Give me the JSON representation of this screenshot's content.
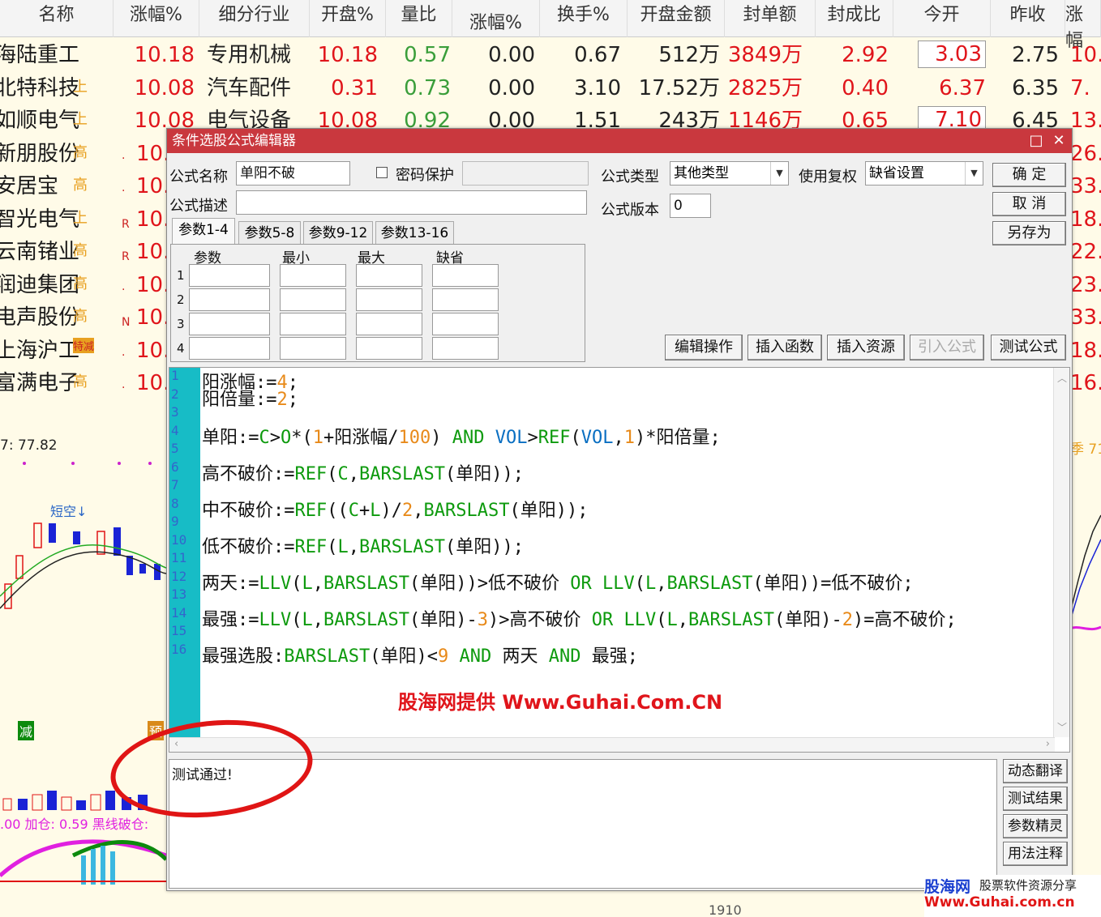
{
  "table": {
    "headers": [
      "名称",
      "涨幅%",
      "细分行业",
      "开盘%",
      "量比",
      "涨幅%",
      "换手%",
      "开盘金额",
      "封单额",
      "封成比",
      "今开",
      "昨收",
      "涨幅"
    ],
    "rows": [
      {
        "name": "海陆重工",
        "tag": "",
        "flag": "",
        "pct": "10.18",
        "industry": "专用机械",
        "open_pct": "10.18",
        "vol_ratio": "0.57",
        "sub_pct": "0.00",
        "turnover": "0.67",
        "open_amt": "512万",
        "seal_amt": "3849万",
        "seal_ratio": "2.92",
        "today_open": "3.03",
        "prev_close": "2.75",
        "last": "10."
      },
      {
        "name": "北特科技",
        "tag": "上",
        "flag": "",
        "pct": "10.08",
        "industry": "汽车配件",
        "open_pct": "0.31",
        "vol_ratio": "0.73",
        "sub_pct": "0.00",
        "turnover": "3.10",
        "open_amt": "17.52万",
        "seal_amt": "2825万",
        "seal_ratio": "0.40",
        "today_open": "6.37",
        "prev_close": "6.35",
        "last": "7."
      },
      {
        "name": "如顺电气",
        "tag": "上",
        "flag": "",
        "pct": "10.08",
        "industry": "电气设备",
        "open_pct": "10.08",
        "vol_ratio": "0.92",
        "sub_pct": "0.00",
        "turnover": "1.51",
        "open_amt": "243万",
        "seal_amt": "1146万",
        "seal_ratio": "0.65",
        "today_open": "7.10",
        "prev_close": "6.45",
        "last": "13."
      },
      {
        "name": "新朋股份",
        "tag": "高",
        "flag": "·",
        "pct": "10.",
        "last": "26."
      },
      {
        "name": "安居宝",
        "tag": "高",
        "flag": "·",
        "pct": "10.",
        "last": "33."
      },
      {
        "name": "智光电气",
        "tag": "上",
        "flag": "R",
        "pct": "10.",
        "last": "18."
      },
      {
        "name": "云南锗业",
        "tag": "高",
        "flag": "R",
        "pct": "10.",
        "last": "22."
      },
      {
        "name": "润迪集团",
        "tag": "高",
        "flag": "·",
        "pct": "10.",
        "last": "23."
      },
      {
        "name": "电声股份",
        "tag": "高",
        "flag": "N",
        "pct": "10.",
        "last": "33."
      },
      {
        "name": "上海沪工",
        "tag": "特减",
        "flag": "·",
        "pct": "10.",
        "last": "18."
      },
      {
        "name": "富满电子",
        "tag": "高",
        "flag": "·",
        "pct": "10.",
        "last": "16."
      }
    ]
  },
  "left_chart": {
    "price_label": "7: 77.82",
    "short_label": "短空↓",
    "reduce_label": "减",
    "pre_label": "预",
    "indicator_label": ".00 加仓: 0.59 黑线破仓:"
  },
  "right_chart": {
    "label": "季 71"
  },
  "bottom_axis": {
    "label": "1910"
  },
  "dialog": {
    "title": "条件选股公式编辑器",
    "min_icon": "□",
    "close_icon": "✕",
    "formula_name_label": "公式名称",
    "formula_name": "单阳不破",
    "password_label": "密码保护",
    "password_value": "",
    "type_label": "公式类型",
    "type_value": "其他类型",
    "adjust_label": "使用复权",
    "adjust_value": "缺省设置",
    "desc_label": "公式描述",
    "desc_value": "",
    "version_label": "公式版本",
    "version_value": "0",
    "ok_button": "确  定",
    "cancel_button": "取  消",
    "saveas_button": "另存为",
    "tabs": [
      "参数1-4",
      "参数5-8",
      "参数9-12",
      "参数13-16"
    ],
    "param_headers": [
      "参数",
      "最小",
      "最大",
      "缺省"
    ],
    "param_rows": [
      "1",
      "2",
      "3",
      "4"
    ],
    "action_buttons": [
      "编辑操作",
      "插入函数",
      "插入资源",
      "引入公式",
      "测试公式"
    ],
    "line_numbers": [
      "1",
      "2",
      "3",
      "4",
      "5",
      "6",
      "7",
      "8",
      "9",
      "10",
      "11",
      "12",
      "13",
      "14",
      "15",
      "16"
    ],
    "code": [
      {
        "line": 1,
        "tokens": [
          [
            "阳涨幅",
            "v"
          ],
          [
            ":=",
            "x"
          ],
          [
            "4",
            "n"
          ],
          [
            ";",
            "x"
          ]
        ]
      },
      {
        "line": 2,
        "tokens": [
          [
            "阳倍量",
            "v"
          ],
          [
            ":=",
            "x"
          ],
          [
            "2",
            "n"
          ],
          [
            ";",
            "x"
          ]
        ]
      },
      {
        "line": 4,
        "tokens": [
          [
            "单阳",
            "v"
          ],
          [
            ":=",
            "x"
          ],
          [
            "C",
            "f"
          ],
          [
            ">",
            "x"
          ],
          [
            "O",
            "f"
          ],
          [
            "*(",
            "x"
          ],
          [
            "1",
            "n"
          ],
          [
            "+阳涨幅/",
            "x"
          ],
          [
            "100",
            "n"
          ],
          [
            ") ",
            "x"
          ],
          [
            "AND",
            "f"
          ],
          [
            " ",
            "x"
          ],
          [
            "VOL",
            "b"
          ],
          [
            ">",
            "x"
          ],
          [
            "REF",
            "f"
          ],
          [
            "(",
            "x"
          ],
          [
            "VOL",
            "b"
          ],
          [
            ",",
            "x"
          ],
          [
            "1",
            "n"
          ],
          [
            ")*阳倍量;",
            "x"
          ]
        ]
      },
      {
        "line": 6,
        "tokens": [
          [
            "高不破价",
            "v"
          ],
          [
            ":=",
            "x"
          ],
          [
            "REF",
            "f"
          ],
          [
            "(",
            "x"
          ],
          [
            "C",
            "f"
          ],
          [
            ",",
            "x"
          ],
          [
            "BARSLAST",
            "f"
          ],
          [
            "(单阳));",
            "x"
          ]
        ]
      },
      {
        "line": 8,
        "tokens": [
          [
            "中不破价",
            "v"
          ],
          [
            ":=",
            "x"
          ],
          [
            "REF",
            "f"
          ],
          [
            "((",
            "x"
          ],
          [
            "C",
            "f"
          ],
          [
            "+",
            "x"
          ],
          [
            "L",
            "f"
          ],
          [
            ")/",
            "x"
          ],
          [
            "2",
            "n"
          ],
          [
            ",",
            "x"
          ],
          [
            "BARSLAST",
            "f"
          ],
          [
            "(单阳));",
            "x"
          ]
        ]
      },
      {
        "line": 10,
        "tokens": [
          [
            "低不破价",
            "v"
          ],
          [
            ":=",
            "x"
          ],
          [
            "REF",
            "f"
          ],
          [
            "(",
            "x"
          ],
          [
            "L",
            "f"
          ],
          [
            ",",
            "x"
          ],
          [
            "BARSLAST",
            "f"
          ],
          [
            "(单阳));",
            "x"
          ]
        ]
      },
      {
        "line": 12,
        "tokens": [
          [
            "两天",
            "v"
          ],
          [
            ":=",
            "x"
          ],
          [
            "LLV",
            "f"
          ],
          [
            "(",
            "x"
          ],
          [
            "L",
            "f"
          ],
          [
            ",",
            "x"
          ],
          [
            "BARSLAST",
            "f"
          ],
          [
            "(单阳))>低不破价 ",
            "x"
          ],
          [
            "OR",
            "f"
          ],
          [
            " ",
            "x"
          ],
          [
            "LLV",
            "f"
          ],
          [
            "(",
            "x"
          ],
          [
            "L",
            "f"
          ],
          [
            ",",
            "x"
          ],
          [
            "BARSLAST",
            "f"
          ],
          [
            "(单阳))=低不破价;",
            "x"
          ]
        ]
      },
      {
        "line": 14,
        "tokens": [
          [
            "最强",
            "v"
          ],
          [
            ":=",
            "x"
          ],
          [
            "LLV",
            "f"
          ],
          [
            "(",
            "x"
          ],
          [
            "L",
            "f"
          ],
          [
            ",",
            "x"
          ],
          [
            "BARSLAST",
            "f"
          ],
          [
            "(单阳)-",
            "x"
          ],
          [
            "3",
            "n"
          ],
          [
            ")>高不破价 ",
            "x"
          ],
          [
            "OR",
            "f"
          ],
          [
            " ",
            "x"
          ],
          [
            "LLV",
            "f"
          ],
          [
            "(",
            "x"
          ],
          [
            "L",
            "f"
          ],
          [
            ",",
            "x"
          ],
          [
            "BARSLAST",
            "f"
          ],
          [
            "(单阳)-",
            "x"
          ],
          [
            "2",
            "n"
          ],
          [
            ")=高不破价;",
            "x"
          ]
        ]
      },
      {
        "line": 16,
        "tokens": [
          [
            "最强选股",
            "v"
          ],
          [
            ":",
            "x"
          ],
          [
            "BARSLAST",
            "f"
          ],
          [
            "(单阳)<",
            "x"
          ],
          [
            "9",
            "n"
          ],
          [
            " ",
            "x"
          ],
          [
            "AND",
            "f"
          ],
          [
            " 两天 ",
            "x"
          ],
          [
            "AND",
            "f"
          ],
          [
            " 最强;",
            "x"
          ]
        ]
      }
    ],
    "output_text": "测试通过!",
    "side_buttons": [
      "动态翻译",
      "测试结果",
      "参数精灵",
      "用法注释"
    ]
  },
  "watermark": "股海网提供 Www.Guhai.Com.CN",
  "brand": {
    "name": "股海网",
    "slogan": "股票软件资源分享",
    "url": "Www.Guhai.com.cn"
  }
}
